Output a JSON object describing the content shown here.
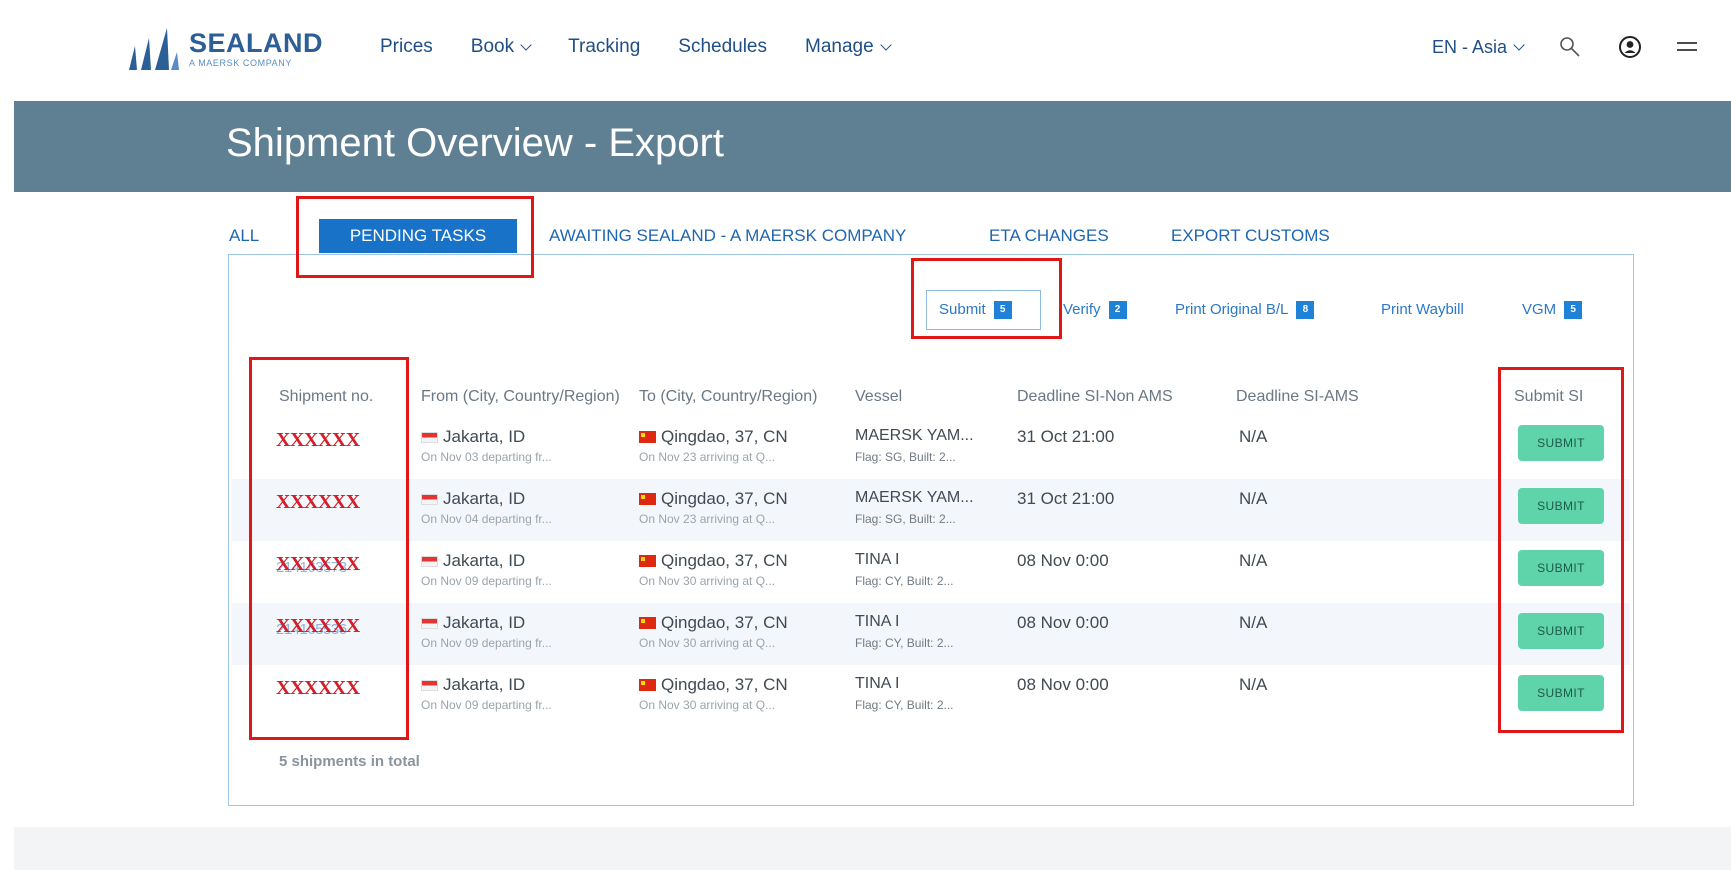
{
  "brand": {
    "name": "SEALAND",
    "tagline": "A MAERSK COMPANY",
    "logo_icon": "sails-logo-icon"
  },
  "nav": {
    "prices": "Prices",
    "book": "Book",
    "tracking": "Tracking",
    "schedules": "Schedules",
    "manage": "Manage"
  },
  "header_right": {
    "language": "EN - Asia",
    "search_icon": "search-icon",
    "account_icon": "user-icon",
    "menu_icon": "hamburger-menu-icon"
  },
  "page_title": "Shipment Overview - Export",
  "tabs": {
    "all": "ALL",
    "pending": "PENDING TASKS",
    "awaiting": "AWAITING SEALAND - A MAERSK COMPANY",
    "eta": "ETA CHANGES",
    "customs": "EXPORT CUSTOMS"
  },
  "subtabs": {
    "submit": {
      "label": "Submit",
      "count": "5"
    },
    "verify": {
      "label": "Verify",
      "count": "2"
    },
    "print_bl": {
      "label": "Print Original B/L",
      "count": "8"
    },
    "print_waybill": {
      "label": "Print Waybill"
    },
    "vgm": {
      "label": "VGM",
      "count": "5"
    }
  },
  "columns": {
    "shipment_no": "Shipment no.",
    "from": "From (City, Country/Region)",
    "to": "To (City, Country/Region)",
    "vessel": "Vessel",
    "deadline_non_ams": "Deadline SI-Non AMS",
    "deadline_ams": "Deadline SI-AMS",
    "submit_si": "Submit SI"
  },
  "rows": [
    {
      "shipment_no": "XXXXXX",
      "shipment_no_under": "",
      "from": "Jakarta, ID",
      "from_sub": "On Nov 03 departing fr...",
      "to": "Qingdao, 37, CN",
      "to_sub": "On Nov 23 arriving at Q...",
      "vessel": "MAERSK YAM...",
      "vessel_sub": "Flag: SG, Built: 2...",
      "deadline_non_ams": "31 Oct 21:00",
      "deadline_ams": "N/A",
      "action": "SUBMIT"
    },
    {
      "shipment_no": "XXXXXX",
      "shipment_no_under": "",
      "from": "Jakarta, ID",
      "from_sub": "On Nov 04 departing fr...",
      "to": "Qingdao, 37, CN",
      "to_sub": "On Nov 23 arriving at Q...",
      "vessel": "MAERSK YAM...",
      "vessel_sub": "Flag: SG, Built: 2...",
      "deadline_non_ams": "31 Oct 21:00",
      "deadline_ams": "N/A",
      "action": "SUBMIT"
    },
    {
      "shipment_no": "XXXXXX",
      "shipment_no_under": "214163573",
      "from": "Jakarta, ID",
      "from_sub": "On Nov 09 departing fr...",
      "to": "Qingdao, 37, CN",
      "to_sub": "On Nov 30 arriving at Q...",
      "vessel": "TINA I",
      "vessel_sub": "Flag: CY, Built: 2...",
      "deadline_non_ams": "08 Nov 0:00",
      "deadline_ams": "N/A",
      "action": "SUBMIT"
    },
    {
      "shipment_no": "XXXXXX",
      "shipment_no_under": "214165536",
      "from": "Jakarta, ID",
      "from_sub": "On Nov 09 departing fr...",
      "to": "Qingdao, 37, CN",
      "to_sub": "On Nov 30 arriving at Q...",
      "vessel": "TINA I",
      "vessel_sub": "Flag: CY, Built: 2...",
      "deadline_non_ams": "08 Nov 0:00",
      "deadline_ams": "N/A",
      "action": "SUBMIT"
    },
    {
      "shipment_no": "XXXXXX",
      "shipment_no_under": "",
      "from": "Jakarta, ID",
      "from_sub": "On Nov 09 departing fr...",
      "to": "Qingdao, 37, CN",
      "to_sub": "On Nov 30 arriving at Q...",
      "vessel": "TINA I",
      "vessel_sub": "Flag: CY, Built: 2...",
      "deadline_non_ams": "08 Nov 0:00",
      "deadline_ams": "N/A",
      "action": "SUBMIT"
    }
  ],
  "total_text": "5 shipments in total",
  "colors": {
    "brand_blue": "#2b5f95",
    "banner": "#5f7f92",
    "active_tab": "#1873c8",
    "submit_button": "#5fd3a9",
    "highlight": "#e01717"
  }
}
